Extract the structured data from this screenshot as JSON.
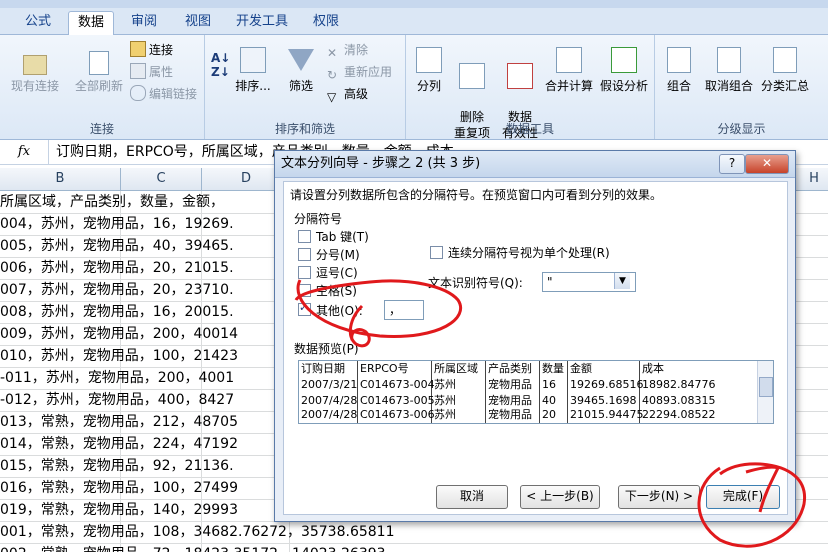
{
  "ribbon_tabs": [
    "公式",
    "数据",
    "审阅",
    "视图",
    "开发工具",
    "权限"
  ],
  "groups": {
    "connections": {
      "label": "连接",
      "existing": "现有连接",
      "refresh_all": "全部刷新",
      "connections": "连接",
      "properties": "属性",
      "edit_links": "编辑链接"
    },
    "sort_filter": {
      "label": "排序和筛选",
      "sort": "排序...",
      "filter": "筛选",
      "clear": "清除",
      "reapply": "重新应用",
      "advanced": "高级"
    },
    "data_tools": {
      "label": "数据工具",
      "split": "分列",
      "remove_dup": "删除\n重复项",
      "validation": "数据\n有效性",
      "consolidate": "合并计算",
      "whatif": "假设分析"
    },
    "outline": {
      "label": "分级显示",
      "group": "组合",
      "ungroup": "取消组合",
      "subtotal": "分类汇总"
    }
  },
  "formula_bar": {
    "fx": "fx",
    "content": "订购日期，ERPCO号，所属区域，产品类别，数量，金额，成本"
  },
  "columns": [
    "B",
    "C",
    "D",
    "H"
  ],
  "rows": [
    "所属区域，产品类别，数量，金额，",
    "004，苏州，宠物用品，16，19269.",
    "005，苏州，宠物用品，40，39465.",
    "006，苏州，宠物用品，20，21015.",
    "007，苏州，宠物用品，20，23710.",
    "008，苏州，宠物用品，16，20015.",
    "009，苏州，宠物用品，200，40014",
    "010，苏州，宠物用品，100，21423",
    "-011，苏州，宠物用品，200，4001",
    "-012，苏州，宠物用品，400，8427",
    "013，常熟，宠物用品，212，48705",
    "014，常熟，宠物用品，224，47192",
    "015，常熟，宠物用品，92，21136.",
    "016，常熟，宠物用品，100，27499",
    "019，常熟，宠物用品，140，29993",
    "001，常熟，宠物用品，108，34682.76272，35738.65811",
    "002，常熟，宠物用品，72，18423.35172，14023.26393"
  ],
  "dialog": {
    "title": "文本分列向导 - 步骤之 2 (共 3 步)",
    "help": "?",
    "instruction": "请设置分列数据所包含的分隔符号。在预览窗口内可看到分列的效果。",
    "delimiters_label": "分隔符号",
    "tab": "Tab 键(T)",
    "semicolon": "分号(M)",
    "comma": "逗号(C)",
    "space": "空格(S)",
    "other": "其他(O):",
    "other_value": "，",
    "consecutive": "连续分隔符号视为单个处理(R)",
    "qualifier_label": "文本识别符号(Q):",
    "qualifier_value": "\"",
    "preview_label": "数据预览(P)",
    "preview_rows": [
      [
        "订购日期",
        "ERPCO号",
        "所属区域",
        "产品类别",
        "数量",
        "金额",
        "成本"
      ],
      [
        "2007/3/21",
        "C014673-004",
        "苏州",
        "宠物用品",
        "16",
        "19269.68516",
        "18982.84776"
      ],
      [
        "2007/4/28",
        "C014673-005",
        "苏州",
        "宠物用品",
        "40",
        "39465.1698",
        "40893.08315"
      ],
      [
        "2007/4/28",
        "C014673-006",
        "苏州",
        "宠物用品",
        "20",
        "21015.94475",
        "22294.08522"
      ]
    ],
    "cancel": "取消",
    "back": "< 上一步(B)",
    "next": "下一步(N) >",
    "finish": "完成(F)"
  },
  "colors": {
    "annotation_red": "#e0191c",
    "ribbon_blue": "#dbe7f5"
  }
}
